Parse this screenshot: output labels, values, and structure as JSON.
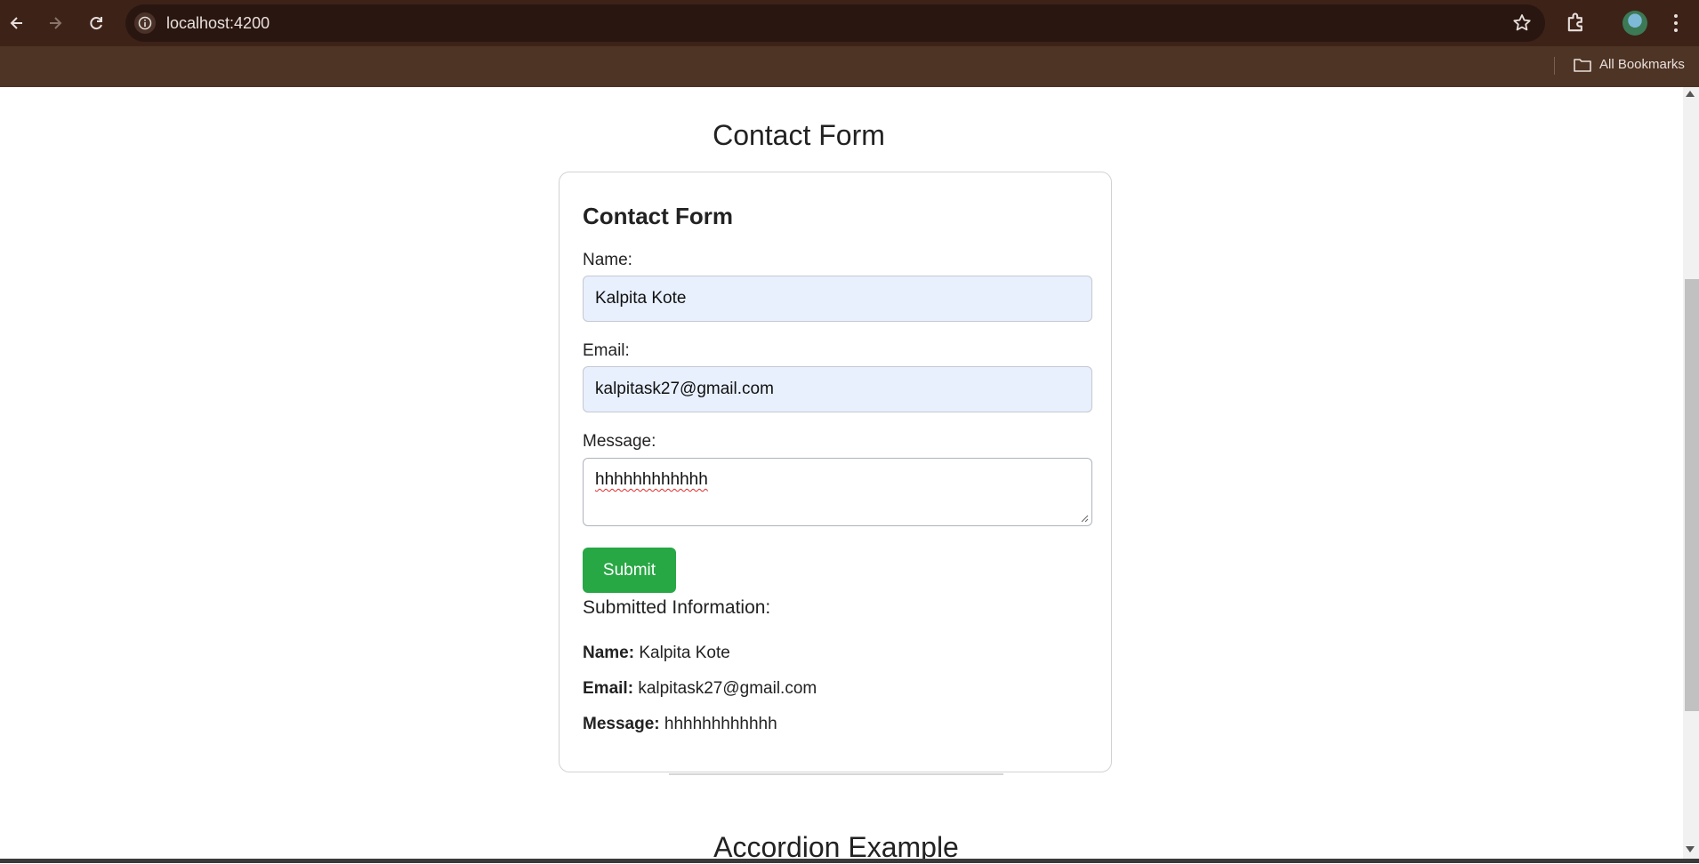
{
  "browser": {
    "url": "localhost:4200",
    "bookmarks_label": "All Bookmarks",
    "icons": {
      "back": "back-arrow-icon",
      "forward": "forward-arrow-icon",
      "reload": "reload-icon",
      "info": "info-icon",
      "star": "star-icon",
      "extensions": "puzzle-icon",
      "menu": "kebab-menu-icon",
      "folder": "folder-icon"
    },
    "colors": {
      "toolbar": "#3d2218",
      "bookmarks_bar": "#4e3425"
    }
  },
  "page": {
    "title": "Contact Form",
    "accordion_title": "Accordion Example"
  },
  "form": {
    "title": "Contact Form",
    "name_label": "Name:",
    "name_value": "Kalpita Kote",
    "email_label": "Email:",
    "email_value": "kalpitask27@gmail.com",
    "message_label": "Message:",
    "message_value": "hhhhhhhhhhhh",
    "submit_label": "Submit",
    "submit_color": "#28a745"
  },
  "submitted": {
    "heading": "Submitted Information:",
    "name_key": "Name:",
    "name_value": "Kalpita Kote",
    "email_key": "Email:",
    "email_value": "kalpitask27@gmail.com",
    "message_key": "Message:",
    "message_value": "hhhhhhhhhhhh"
  }
}
